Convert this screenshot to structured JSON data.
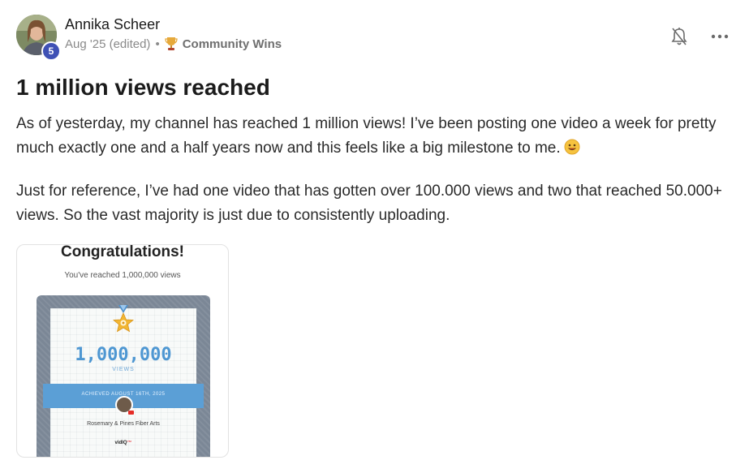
{
  "post": {
    "author": "Annika Scheer",
    "level": "5",
    "date": "Aug '25 (edited)",
    "separator": "•",
    "category": "Community Wins",
    "category_icon": "trophy-icon",
    "title": "1 million views reached",
    "paragraph_1": "As of yesterday, my channel has reached 1 million views! I’ve been posting one video a week for pretty much exactly one and a half years now and this feels like a big milestone to me.",
    "paragraph_2": "Just for reference, I’ve had one video that has gotten over 100.000 views and two that reached 50.000+ views. So the vast majority is just due to consistently uploading."
  },
  "actions": {
    "notify_icon": "bell-off-icon",
    "more_icon": "more-dots-icon"
  },
  "image": {
    "heading": "Congratulations!",
    "subheading": "You've reached 1,000,000 views",
    "milestone": "1,000,000",
    "views_label": "VIEWS",
    "achieved": "ACHIEVED AUGUST 16TH, 2025",
    "channel_name": "Rosemary & Pines Fiber Arts",
    "brand_main": "vidIQ",
    "brand_accent": "™"
  },
  "colors": {
    "badge": "#3f51b5",
    "ribbon": "#5b9fd6",
    "milestone_text": "#4e97d2"
  }
}
